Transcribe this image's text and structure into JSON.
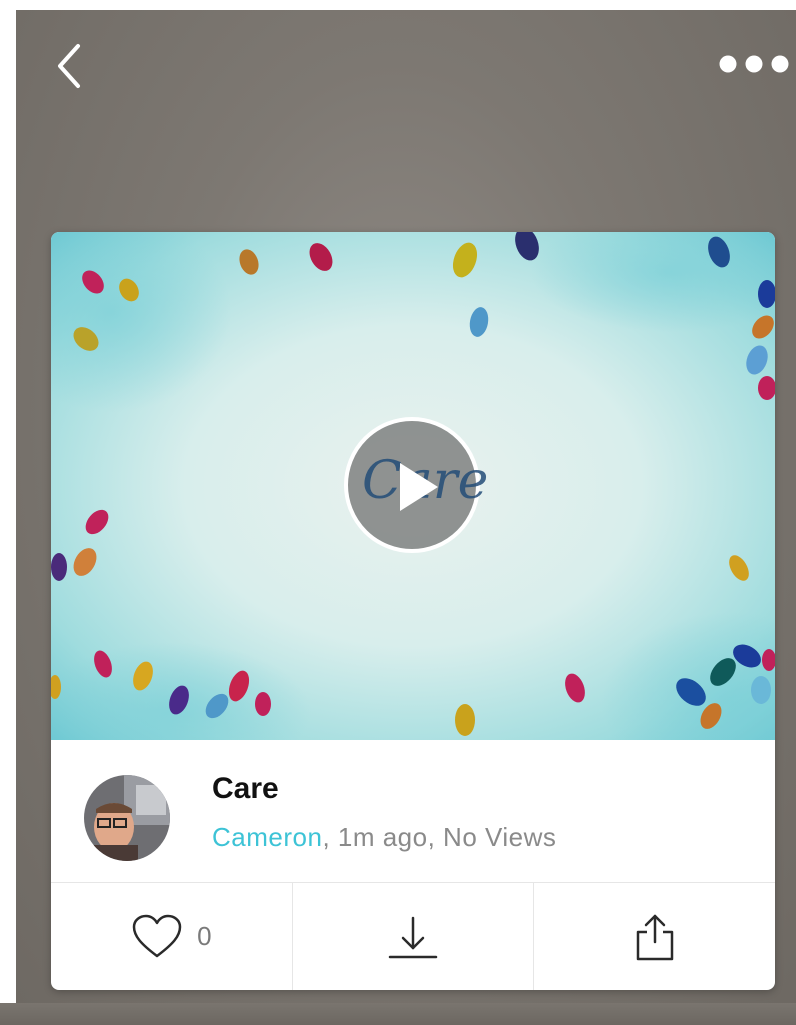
{
  "nav": {
    "back_icon": "chevron-left-icon",
    "more_icon": "ellipsis-icon"
  },
  "video": {
    "thumbnail_text": "Care",
    "play_icon": "play-icon",
    "title": "Care",
    "author": "Cameron",
    "meta_rest": ", 1m ago, No Views"
  },
  "actions": {
    "like_count": "0",
    "like_icon": "heart-icon",
    "download_icon": "download-icon",
    "share_icon": "share-icon"
  },
  "colors": {
    "author_link": "#3dc3d6",
    "background": "#7d7872",
    "card": "#ffffff"
  }
}
